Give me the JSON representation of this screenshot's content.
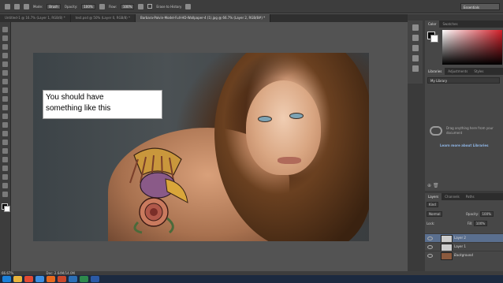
{
  "options_bar": {
    "mode_label": "Mode:",
    "mode_value": "Brush",
    "opacity_label": "Opacity:",
    "opacity_value": "100%",
    "flow_label": "Flow:",
    "flow_value": "100%",
    "erase_history_label": "Erase to History",
    "workspace": "Essentials"
  },
  "tabs": [
    {
      "label": "Untitled-1 @ 16.7% (Layer 1, RGB/8) *"
    },
    {
      "label": "test.psd @ 50% (Layer 0, RGB/8) *"
    },
    {
      "label": "Barbara-Palvin-Model-Full-HD-Wallpaper-4 (1).jpg @ 66.7% (Layer 2, RGB/8#) *"
    }
  ],
  "caption": {
    "line1": "You should have",
    "line2": "something like this"
  },
  "color_panel": {
    "tabs": [
      "Color",
      "Swatches"
    ]
  },
  "libraries_panel": {
    "tabs": [
      "Libraries",
      "Adjustments",
      "Styles"
    ],
    "library_select": "My Library",
    "drag_text": "Drag anything here from your document",
    "learn_link": "Learn more about Libraries"
  },
  "layers_panel": {
    "tabs": [
      "Layers",
      "Channels",
      "Paths"
    ],
    "kind_label": "Kind",
    "blend_mode": "Normal",
    "opacity_label": "Opacity:",
    "opacity_value": "100%",
    "lock_label": "Lock:",
    "fill_label": "Fill:",
    "fill_value": "100%",
    "layers": [
      {
        "name": "Layer 2",
        "selected": true
      },
      {
        "name": "Layer 1",
        "selected": false
      },
      {
        "name": "Background",
        "selected": false
      }
    ]
  },
  "status_bar": {
    "zoom": "66.67%",
    "doc": "Doc: 2.64M/14.0M"
  },
  "taskbar": {
    "icons": [
      "windows-start-icon",
      "explorer-icon",
      "chrome-icon",
      "browser-icon",
      "media-icon",
      "powerpoint-icon",
      "photoshop-icon",
      "excel-icon",
      "word-icon"
    ],
    "colors": [
      "#1c80d8",
      "#e7b33c",
      "#e24a33",
      "#3d8ee0",
      "#e66a1f",
      "#c9472b",
      "#2c6fb6",
      "#2d8a4c",
      "#2b5aa6"
    ]
  }
}
